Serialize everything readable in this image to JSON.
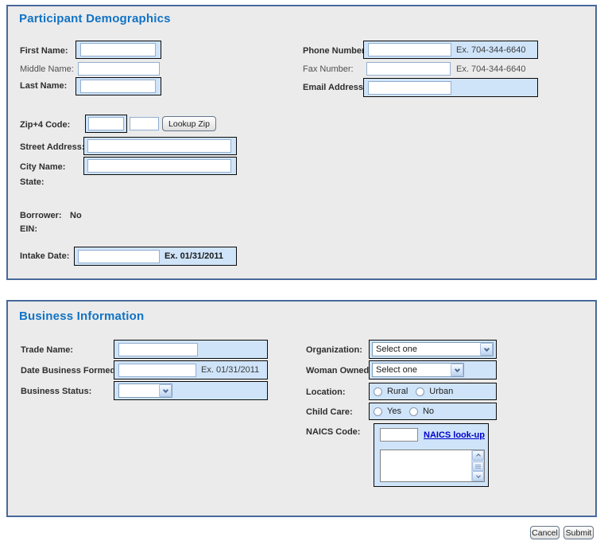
{
  "colors": {
    "panel_border": "#47699b",
    "panel_background": "#ebebeb",
    "heading_blue": "#1173c5",
    "highlight_blue": "#cfe4f9",
    "link_blue": "#0000cc"
  },
  "participant": {
    "title": "Participant Demographics",
    "first_name_label": "First Name:",
    "middle_name_label": "Middle Name:",
    "last_name_label": "Last Name:",
    "phone_label": "Phone Number:",
    "phone_example": "Ex. 704-344-6640",
    "fax_label": "Fax Number:",
    "fax_example": "Ex. 704-344-6640",
    "email_label": "Email Address:",
    "zip_label": "Zip+4 Code:",
    "lookup_zip_button": "Lookup Zip",
    "street_label": "Street Address:",
    "city_label": "City Name:",
    "state_label": "State:",
    "borrower_label": "Borrower:",
    "borrower_value": "No",
    "ein_label": "EIN:",
    "intake_label": "Intake Date:",
    "intake_example": "Ex. 01/31/2011"
  },
  "business": {
    "title": "Business Information",
    "trade_name_label": "Trade Name:",
    "date_formed_label": "Date Business Formed:",
    "date_formed_example": "Ex. 01/31/2011",
    "business_status_label": "Business Status:",
    "organization_label": "Organization:",
    "organization_value": "Select one",
    "woman_owned_label": "Woman Owned:",
    "woman_owned_value": "Select one",
    "location_label": "Location:",
    "location_options": [
      "Rural",
      "Urban"
    ],
    "child_care_label": "Child Care:",
    "child_care_options": [
      "Yes",
      "No"
    ],
    "naics_label": "NAICS Code:",
    "naics_link": "NAICS look-up"
  },
  "footer": {
    "cancel_label": "Cancel",
    "submit_label": "Submit"
  }
}
